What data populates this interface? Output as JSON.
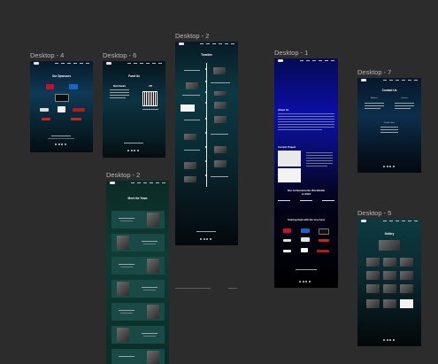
{
  "canvas": {
    "background": "#2c2c2c"
  },
  "frames": {
    "d4": {
      "label": "Desktop - 4",
      "heading": "Our Sponsors",
      "sponsors": [
        "sponsor-logo-1",
        "sponsor-logo-2",
        "sponsor-logo-3",
        "sponsor-logo-4",
        "sponsor-logo-5",
        "sponsor-logo-6"
      ]
    },
    "d6": {
      "label": "Desktop - 6",
      "heading": "Fund Us",
      "bank_title": "Bank Details",
      "upi_title": "UPI"
    },
    "d2a": {
      "label": "Desktop - 2",
      "heading": "Timeline",
      "years": [
        "2013",
        "2014",
        "2015",
        "2016",
        "2017",
        "2018",
        "2019",
        "2020",
        "2021",
        "2022",
        "2023",
        "2024"
      ]
    },
    "d2b": {
      "label": "Desktop - 2",
      "heading": "Meet the Team"
    },
    "d1": {
      "label": "Desktop - 1",
      "about_heading": "About Us",
      "project_heading": "Current Project",
      "achievements_heading": "Our Achievements Worldwide",
      "achievements_sub": "in 2024",
      "sponsors_heading": "Soaring High with the very best"
    },
    "d7": {
      "label": "Desktop - 7",
      "heading": "Contact Us",
      "col_left": "Address",
      "col_right": "Contact",
      "social_heading": "Social Links"
    },
    "d5": {
      "label": "Desktop - 5",
      "heading": "Gallery"
    }
  }
}
